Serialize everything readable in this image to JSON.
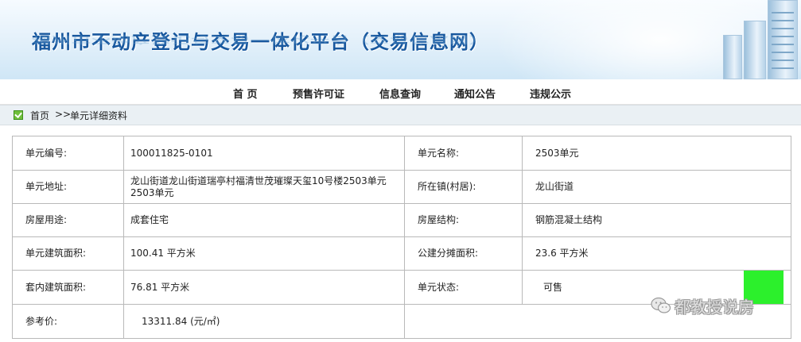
{
  "header": {
    "title": "福州市不动产登记与交易一体化平台（交易信息网）"
  },
  "nav": {
    "items": [
      "首 页",
      "预售许可证",
      "信息查询",
      "通知公告",
      "违规公示"
    ]
  },
  "breadcrumb": {
    "home": "首页",
    "separator": ">>",
    "current": "单元详细资料"
  },
  "detail": {
    "unit_no_label": "单元编号:",
    "unit_no": "100011825-0101",
    "unit_name_label": "单元名称:",
    "unit_name": "2503单元",
    "address_label": "单元地址:",
    "address": "龙山街道龙山街道瑞亭村福清世茂璀璨天玺10号楼2503单元2503单元",
    "town_label": "所在镇(村居):",
    "town": "龙山街道",
    "usage_label": "房屋用途:",
    "usage": "成套住宅",
    "structure_label": "房屋结构:",
    "structure": "钢筋混凝土结构",
    "build_area_label": "单元建筑面积:",
    "build_area": "100.41 平方米",
    "shared_area_label": "公建分摊面积:",
    "shared_area": "23.6 平方米",
    "inner_area_label": "套内建筑面积:",
    "inner_area": "76.81 平方米",
    "status_label": "单元状态:",
    "status": "可售",
    "ref_price_label": "参考价:",
    "ref_price": "13311.84 (元/㎡)"
  },
  "watermark": {
    "icon": "wechat-icon",
    "text": "都教授说房"
  },
  "colors": {
    "title": "#17579e",
    "status_available": "#2cf02c",
    "breadcrumb_bg": "#eaf0f4",
    "table_border": "#b9b9b9"
  }
}
